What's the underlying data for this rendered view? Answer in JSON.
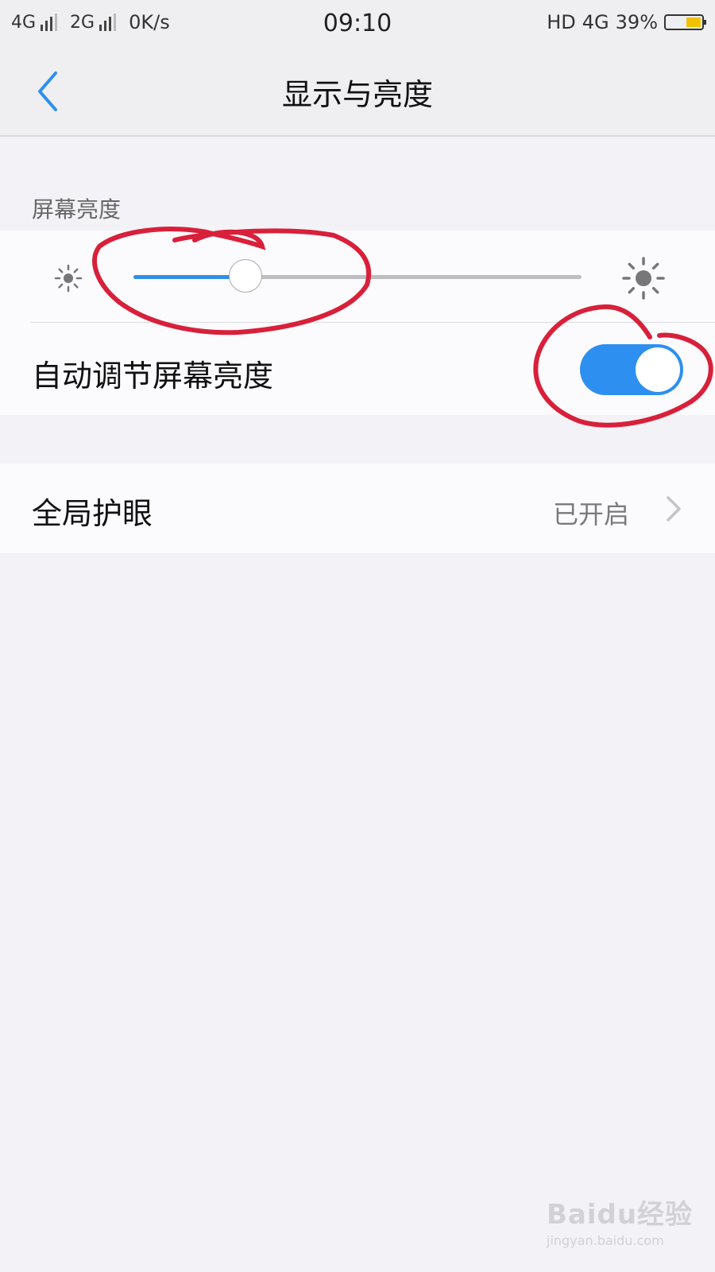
{
  "status_bar": {
    "network1": "4G",
    "network2": "2G",
    "speed": "0K/s",
    "time": "09:10",
    "hd": "HD",
    "data_type": "4G",
    "battery": "39%"
  },
  "nav": {
    "title": "显示与亮度",
    "back_icon": "chevron-left-icon"
  },
  "brightness": {
    "section_label": "屏幕亮度",
    "slider_level": 0.25,
    "auto_label": "自动调节屏幕亮度",
    "auto_enabled": true
  },
  "eye_care": {
    "label": "全局护眼",
    "status": "已开启"
  },
  "watermark": {
    "logo": "Baidu经验",
    "url": "jingyan.baidu.com"
  },
  "colors": {
    "accent": "#2d8ff0",
    "annotation": "#d8203a"
  }
}
